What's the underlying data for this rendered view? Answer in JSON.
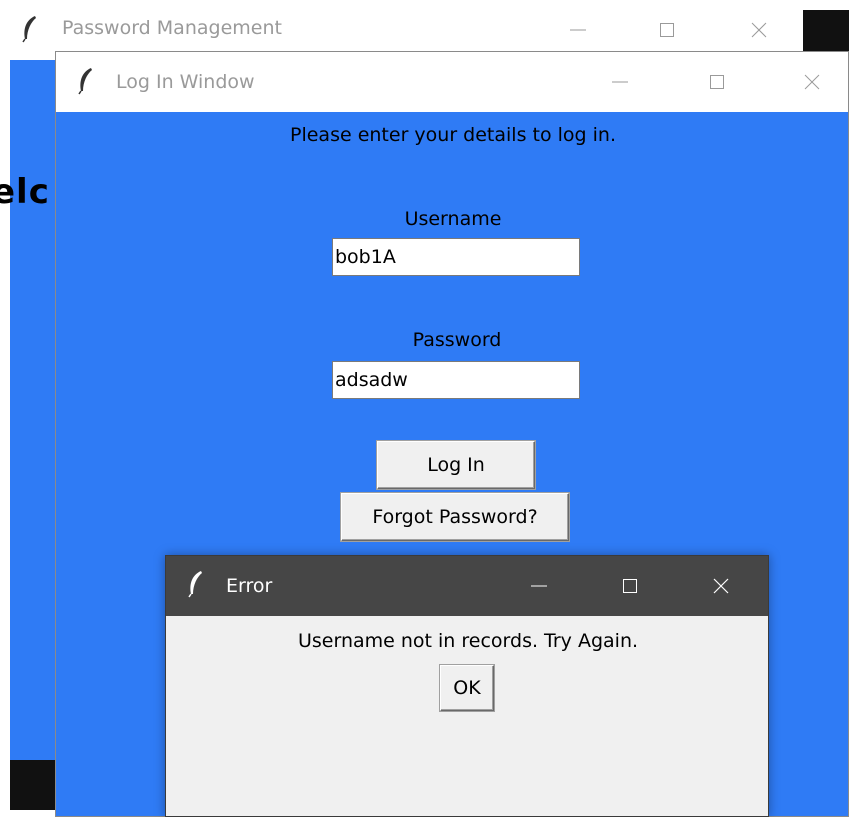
{
  "main_window": {
    "title": "Password Management",
    "welcome_fragment": "elc",
    "controls": {
      "minimize": "minimize-icon",
      "maximize": "maximize-icon",
      "close": "close-icon"
    }
  },
  "login_window": {
    "title": "Log In Window",
    "prompt": "Please enter your details to log in.",
    "username_label": "Username",
    "username_value": "bob1A",
    "password_label": "Password",
    "password_value": "adsadw",
    "login_button": "Log In",
    "forgot_button": "Forgot Password?"
  },
  "error_dialog": {
    "title": "Error",
    "message": "Username not in records. Try Again.",
    "ok_button": "OK"
  },
  "colors": {
    "window_background": "#2f7bf5",
    "dialog_background": "#f0f0f0",
    "active_titlebar": "#464646"
  }
}
